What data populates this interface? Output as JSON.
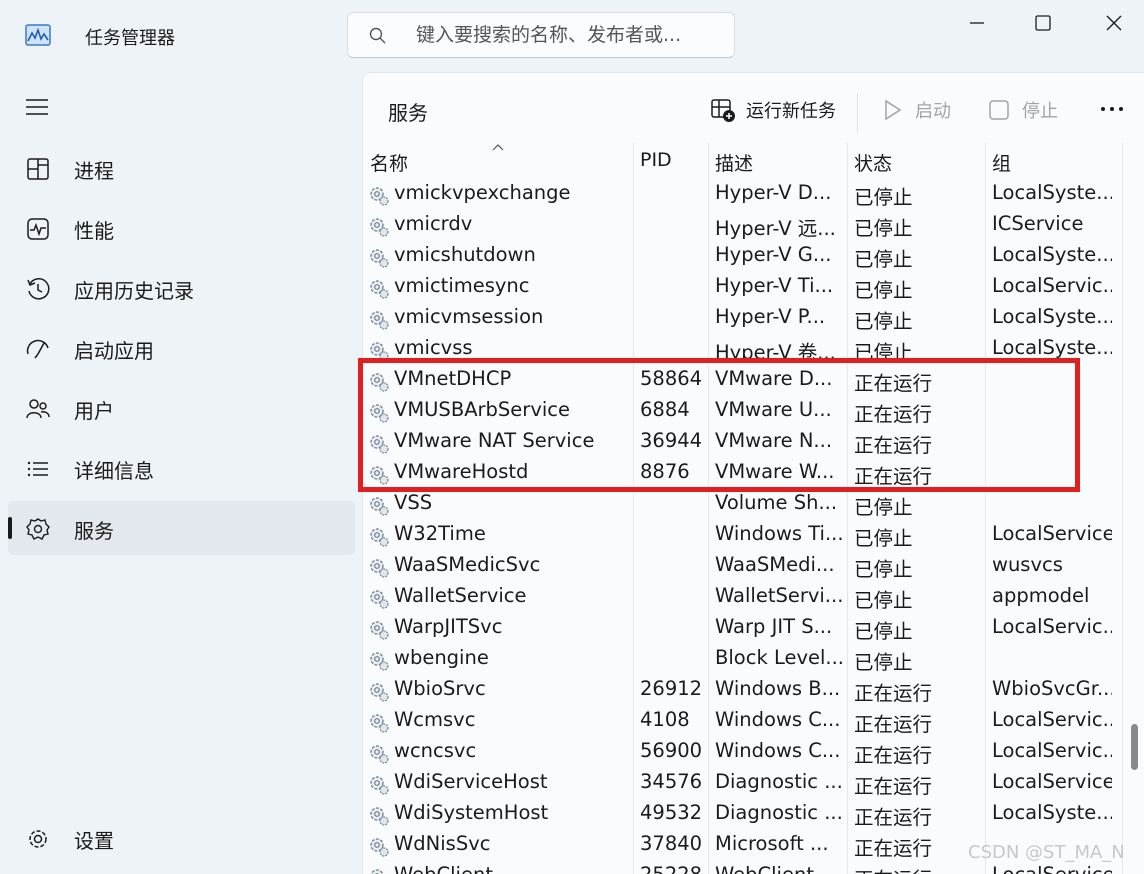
{
  "app": {
    "title": "任务管理器"
  },
  "search": {
    "placeholder": "键入要搜索的名称、发布者或..."
  },
  "sidebar": {
    "items": [
      {
        "label": "进程",
        "icon": "processes-icon"
      },
      {
        "label": "性能",
        "icon": "performance-icon"
      },
      {
        "label": "应用历史记录",
        "icon": "app-history-icon"
      },
      {
        "label": "启动应用",
        "icon": "startup-apps-icon"
      },
      {
        "label": "用户",
        "icon": "users-icon"
      },
      {
        "label": "详细信息",
        "icon": "details-icon"
      },
      {
        "label": "服务",
        "icon": "services-icon",
        "active": true
      }
    ],
    "settings": {
      "label": "设置",
      "icon": "settings-icon"
    }
  },
  "panel": {
    "title": "服务",
    "toolbar": {
      "run_new_task": "运行新任务",
      "start": "启动",
      "stop": "停止"
    }
  },
  "table": {
    "columns": {
      "name": "名称",
      "pid": "PID",
      "desc": "描述",
      "status": "状态",
      "group": "组"
    },
    "rows": [
      {
        "name": "vmickvpexchange",
        "pid": "",
        "desc": "Hyper-V D...",
        "status": "已停止",
        "group": "LocalSyste..."
      },
      {
        "name": "vmicrdv",
        "pid": "",
        "desc": "Hyper-V 远...",
        "status": "已停止",
        "group": "ICService"
      },
      {
        "name": "vmicshutdown",
        "pid": "",
        "desc": "Hyper-V G...",
        "status": "已停止",
        "group": "LocalSyste..."
      },
      {
        "name": "vmictimesync",
        "pid": "",
        "desc": "Hyper-V Ti...",
        "status": "已停止",
        "group": "LocalServic..."
      },
      {
        "name": "vmicvmsession",
        "pid": "",
        "desc": "Hyper-V P...",
        "status": "已停止",
        "group": "LocalSyste..."
      },
      {
        "name": "vmicvss",
        "pid": "",
        "desc": "Hyper-V 卷...",
        "status": "已停止",
        "group": "LocalSyste..."
      },
      {
        "name": "VMnetDHCP",
        "pid": "58864",
        "desc": "VMware D...",
        "status": "正在运行",
        "group": ""
      },
      {
        "name": "VMUSBArbService",
        "pid": "6884",
        "desc": "VMware U...",
        "status": "正在运行",
        "group": ""
      },
      {
        "name": "VMware NAT Service",
        "pid": "36944",
        "desc": "VMware N...",
        "status": "正在运行",
        "group": ""
      },
      {
        "name": "VMwareHostd",
        "pid": "8876",
        "desc": "VMware W...",
        "status": "正在运行",
        "group": ""
      },
      {
        "name": "VSS",
        "pid": "",
        "desc": "Volume Sh...",
        "status": "已停止",
        "group": ""
      },
      {
        "name": "W32Time",
        "pid": "",
        "desc": "Windows Ti...",
        "status": "已停止",
        "group": "LocalService"
      },
      {
        "name": "WaaSMedicSvc",
        "pid": "",
        "desc": "WaaSMedi...",
        "status": "已停止",
        "group": "wusvcs"
      },
      {
        "name": "WalletService",
        "pid": "",
        "desc": "WalletServi...",
        "status": "已停止",
        "group": "appmodel"
      },
      {
        "name": "WarpJITSvc",
        "pid": "",
        "desc": "Warp JIT S...",
        "status": "已停止",
        "group": "LocalServic..."
      },
      {
        "name": "wbengine",
        "pid": "",
        "desc": "Block Level...",
        "status": "已停止",
        "group": ""
      },
      {
        "name": "WbioSrvc",
        "pid": "26912",
        "desc": "Windows B...",
        "status": "正在运行",
        "group": "WbioSvcGr..."
      },
      {
        "name": "Wcmsvc",
        "pid": "4108",
        "desc": "Windows C...",
        "status": "正在运行",
        "group": "LocalServic..."
      },
      {
        "name": "wcncsvc",
        "pid": "56900",
        "desc": "Windows C...",
        "status": "正在运行",
        "group": "LocalServic..."
      },
      {
        "name": "WdiServiceHost",
        "pid": "34576",
        "desc": "Diagnostic ...",
        "status": "正在运行",
        "group": "LocalService"
      },
      {
        "name": "WdiSystemHost",
        "pid": "49532",
        "desc": "Diagnostic ...",
        "status": "正在运行",
        "group": "LocalSyste..."
      },
      {
        "name": "WdNisSvc",
        "pid": "37840",
        "desc": "Microsoft ...",
        "status": "正在运行",
        "group": ""
      },
      {
        "name": "WebClient",
        "pid": "25228",
        "desc": "WebClient ...",
        "status": "正在运行",
        "group": "LocalService"
      }
    ]
  },
  "annotation": {
    "color": "#e02020"
  },
  "watermark": "CSDN @ST_MA_N"
}
